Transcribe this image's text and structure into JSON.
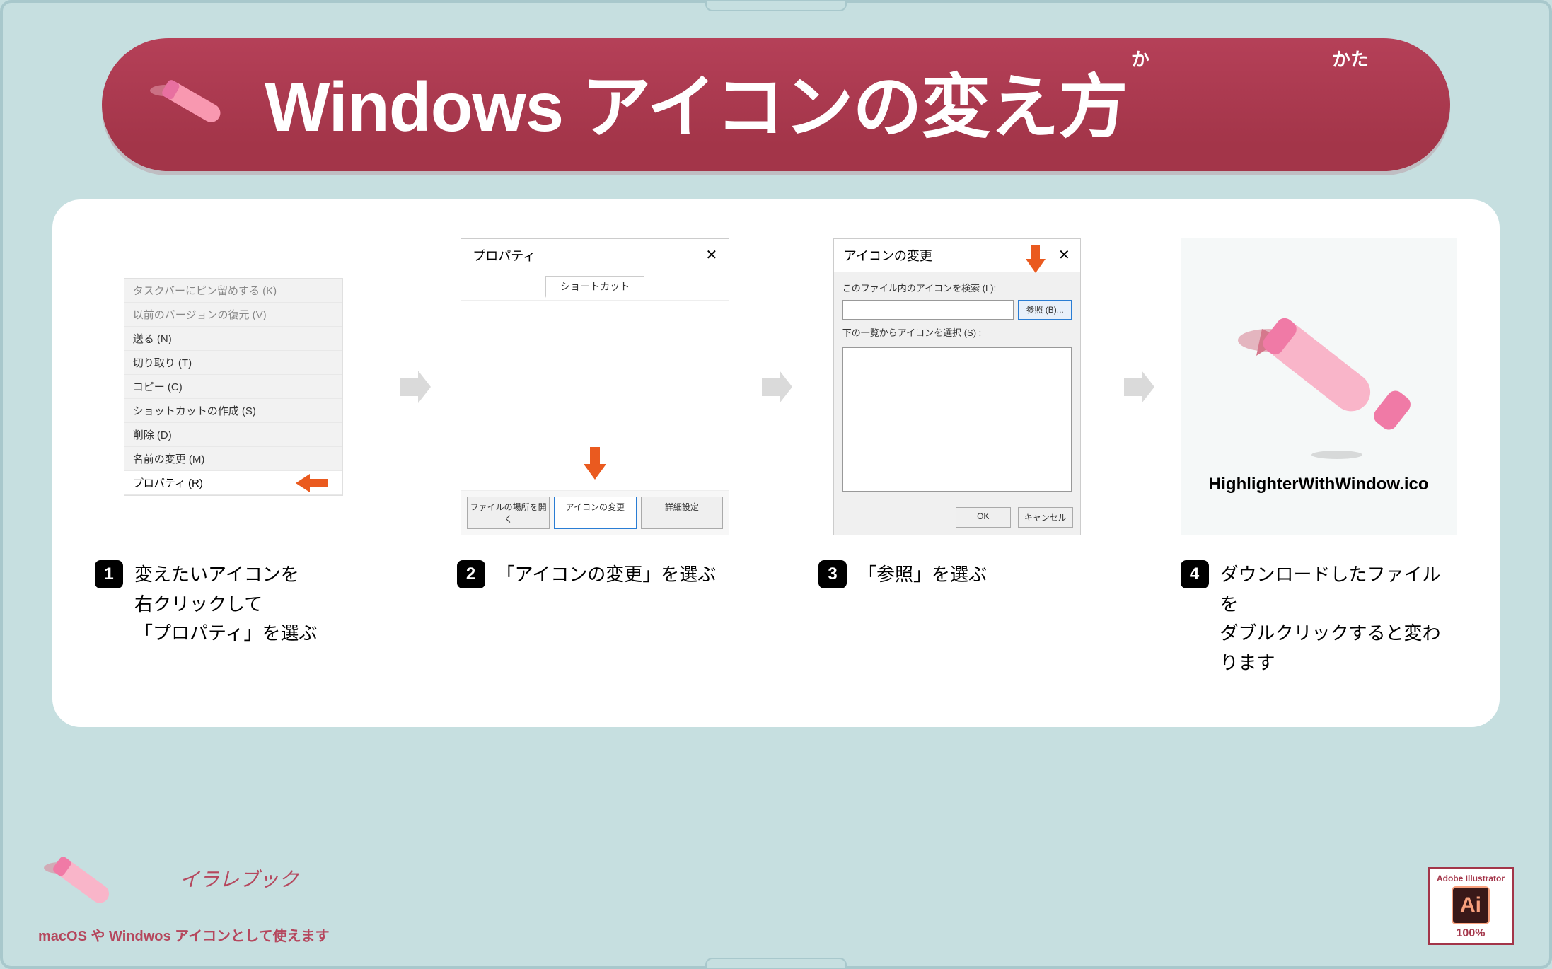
{
  "header": {
    "title": "Windows アイコンの変え方",
    "ruby1": "か",
    "ruby2": "かた"
  },
  "steps": {
    "s1": {
      "num": "1",
      "text": "変えたいアイコンを\n右クリックして\n「プロパティ」を選ぶ",
      "menu": {
        "i1": "タスクバーにピン留めする (K)",
        "i2": "以前のバージョンの復元 (V)",
        "i3": "送る (N)",
        "i4": "切り取り (T)",
        "i5": "コピー (C)",
        "i6": "ショットカットの作成 (S)",
        "i7": "削除 (D)",
        "i8": "名前の変更 (M)",
        "i9": "プロパティ (R)"
      }
    },
    "s2": {
      "num": "2",
      "text": "「アイコンの変更」を選ぶ",
      "win": {
        "title": "プロパティ",
        "tab": "ショートカット",
        "b1": "ファイルの場所を開く",
        "b2": "アイコンの変更",
        "b3": "詳細設定"
      }
    },
    "s3": {
      "num": "3",
      "text": "「参照」を選ぶ",
      "win": {
        "title": "アイコンの変更",
        "l1": "このファイル内のアイコンを検索 (L):",
        "browse": "参照 (B)...",
        "l2": "下の一覧からアイコンを選択 (S) :",
        "ok": "OK",
        "cancel": "キャンセル"
      }
    },
    "s4": {
      "num": "4",
      "text": "ダウンロードしたファイルを\nダブルクリックすると変わります",
      "filename": "HighlighterWithWindow.ico"
    }
  },
  "footer": {
    "brand": "イラレブック",
    "note": "macOS や Windwos アイコンとして使えます",
    "ai_label": "Adobe Illustrator",
    "ai_text": "Ai",
    "ai_pct": "100%"
  }
}
